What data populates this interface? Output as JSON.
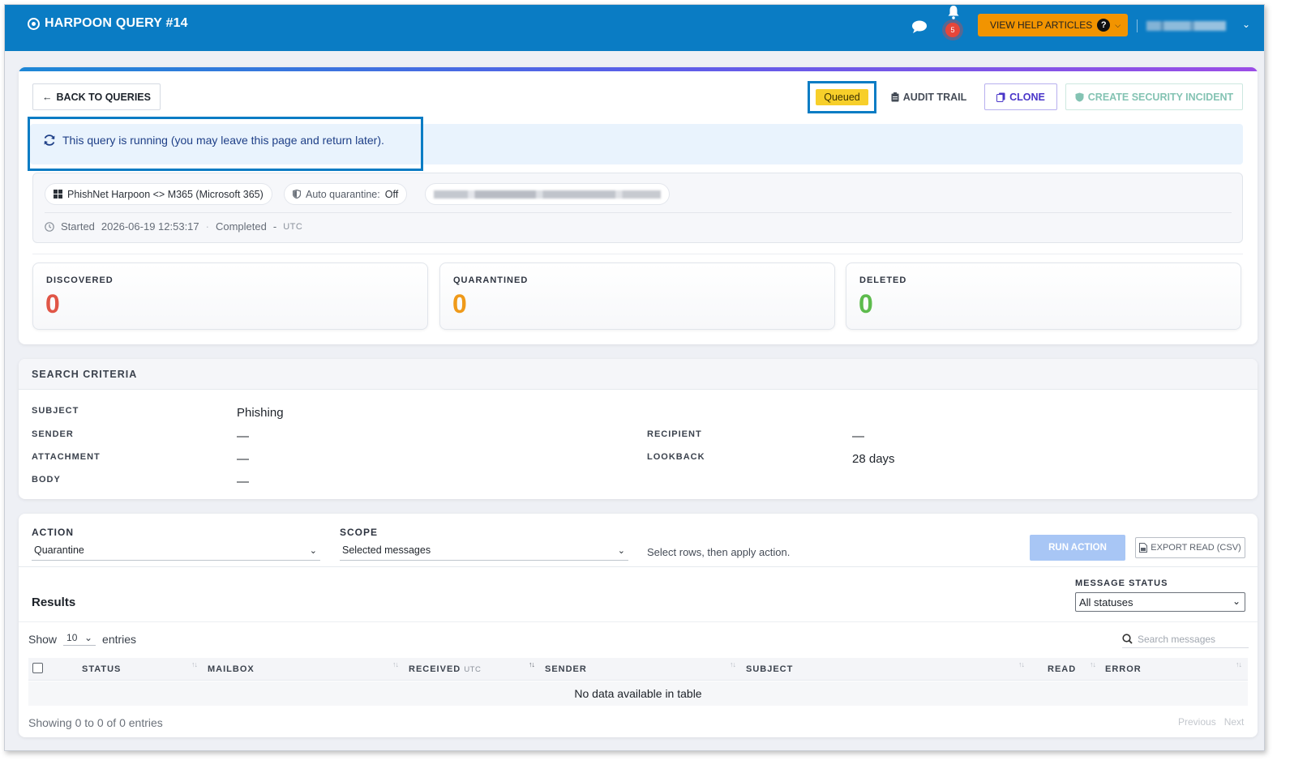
{
  "header": {
    "title": "HARPOON QUERY #14",
    "notification_count": "5",
    "help_label": "VIEW HELP ARTICLES",
    "help_icon": "?",
    "user_name_blurred": ""
  },
  "toolbar": {
    "back_label": "BACK TO QUERIES",
    "status": "Queued",
    "audit_label": "AUDIT TRAIL",
    "clone_label": "CLONE",
    "incident_label": "CREATE SECURITY INCIDENT"
  },
  "banner": {
    "running_text": "This query is running (you may leave this page and return later)."
  },
  "meta": {
    "integration": "PhishNet Harpoon <> M365 (Microsoft 365)",
    "auto_quarantine_label": "Auto quarantine:",
    "auto_quarantine_value": "Off",
    "started_label": "Started",
    "started_value": "2026-06-19 12:53:17",
    "separator": "·",
    "completed_label": "Completed",
    "completed_value": "-",
    "timezone": "UTC"
  },
  "stats": [
    {
      "label": "DISCOVERED",
      "value": "0"
    },
    {
      "label": "QUARANTINED",
      "value": "0"
    },
    {
      "label": "DELETED",
      "value": "0"
    }
  ],
  "criteria": {
    "title": "SEARCH CRITERIA",
    "subject_label": "SUBJECT",
    "subject_value": "Phishing",
    "sender_label": "SENDER",
    "sender_value": "—",
    "attachment_label": "ATTACHMENT",
    "attachment_value": "—",
    "body_label": "BODY",
    "body_value": "—",
    "recipient_label": "RECIPIENT",
    "recipient_value": "—",
    "lookback_label": "LOOKBACK",
    "lookback_value": "28 days"
  },
  "actions": {
    "action_label": "ACTION",
    "action_value": "Quarantine",
    "scope_label": "SCOPE",
    "scope_value": "Selected messages",
    "hint": "Select rows, then apply action.",
    "run_label": "RUN ACTION",
    "export_label": "EXPORT READ (CSV)"
  },
  "results": {
    "title": "Results",
    "message_status_label": "MESSAGE STATUS",
    "message_status_value": "All statuses",
    "show_label": "Show",
    "page_length": "10",
    "entries_label": "entries",
    "search_placeholder": "Search messages",
    "columns": [
      "STATUS",
      "MAILBOX",
      "RECEIVED",
      "SENDER",
      "SUBJECT",
      "READ",
      "ERROR"
    ],
    "received_sub": "UTC",
    "empty_text": "No data available in table",
    "showing_text": "Showing 0 to 0 of 0 entries",
    "prev_label": "Previous",
    "next_label": "Next"
  },
  "colors": {
    "topbar": "#0a7cc4",
    "help_button": "#f29400",
    "queued_badge": "#f7cf2a",
    "discovered": "#e05647",
    "quarantined": "#ef9a1a",
    "deleted": "#5dbb4d",
    "highlight_box": "#0a7cc4"
  },
  "icons": {
    "brand": "target-icon",
    "chat": "chat-bubble-icon",
    "bell": "bell-icon",
    "back": "arrow-left-icon",
    "audit": "clipboard-icon",
    "clone": "copy-icon",
    "incident": "shield-icon",
    "refresh": "refresh-icon",
    "windows": "windows-logo-icon",
    "clock": "clock-icon",
    "search": "search-icon",
    "export": "file-csv-icon"
  }
}
